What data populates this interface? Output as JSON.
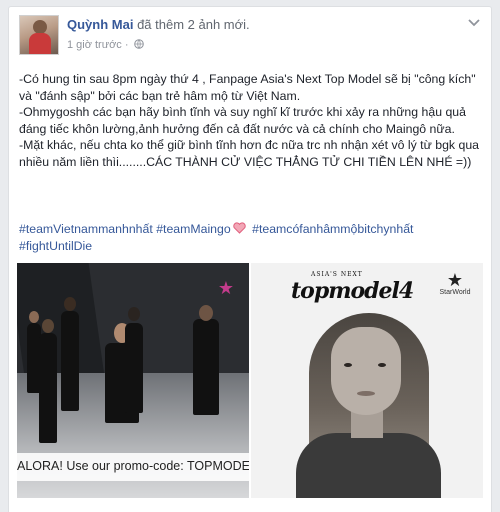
{
  "post": {
    "author": "Quỳnh Mai",
    "action": "đã thêm 2 ảnh mới.",
    "timestamp": "1 giờ trước",
    "separator": "·",
    "paragraphs": [
      "-Có hung tin sau 8pm ngày thứ 4 , Fanpage Asia's Next Top Model sẽ bị \"công kích\" và \"đánh sập\" bởi các bạn trẻ hâm mộ từ Việt Nam.",
      "-Ohmygoshh các bạn hãy bình tĩnh và suy nghĩ kĩ trước khi xảy ra những hậu quả đáng tiếc khôn lường,ảnh hưởng đến cả đất nước và cả chính cho Maingô nữa.",
      "-Mặt khác, nếu chta ko thể giữ bình tĩnh hơn đc nữa trc nh nhận xét vô lý từ bgk qua nhiều năm liền thìi........CÁC THÀNH CỬ VIỆC THẲNG TỬ CHI TIỀN LÊN NHÉ =))"
    ],
    "hashtags": [
      "#teamVietnammanhnhất",
      "#teamMaingo",
      "#teamcófanhâmmộbitchynhất",
      "#fightUntilDie"
    ]
  },
  "photos": {
    "left_banner": "ALORA! Use our promo-code: TOPMODEL",
    "right_logo_small": "ASIA'S NEXT",
    "right_logo_big": "topmodel4",
    "right_brand": "StarWorld"
  },
  "icons": [
    "globe-icon",
    "chevron-down-icon",
    "heart-icon",
    "star-icon"
  ],
  "colors": {
    "link": "#365899",
    "meta": "#90949c",
    "heart": "#e0607e"
  }
}
